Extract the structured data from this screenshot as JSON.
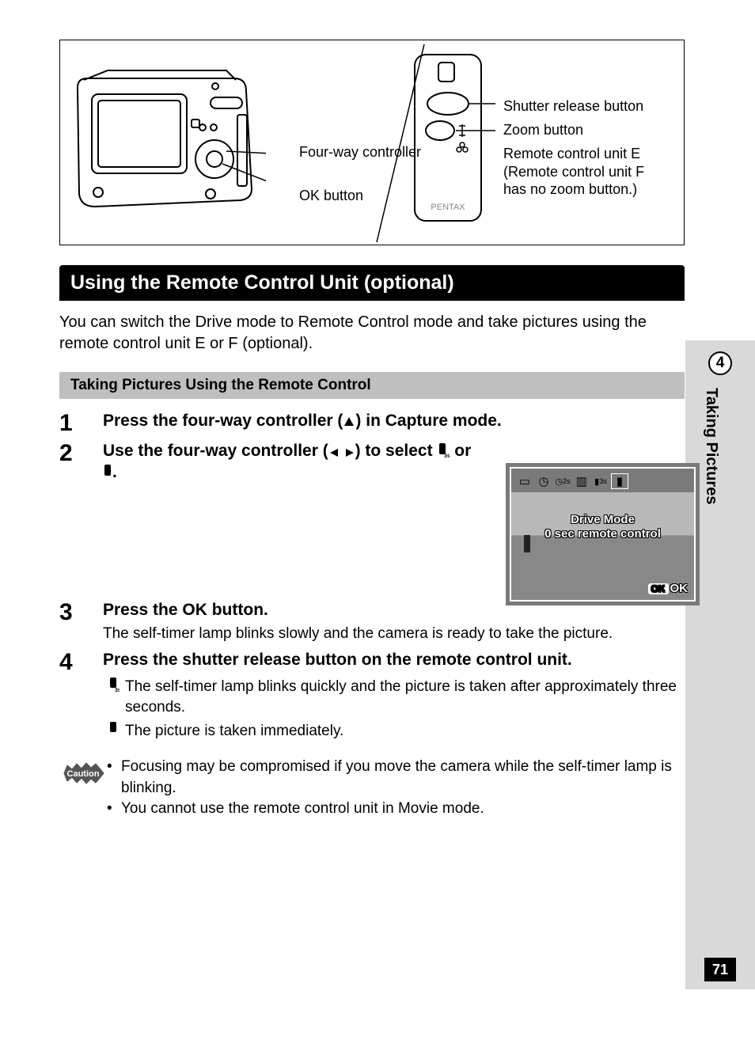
{
  "diagram": {
    "camera_labels": {
      "fourway": "Four-way controller",
      "ok": "OK button"
    },
    "remote_labels": {
      "shutter": "Shutter release button",
      "zoom": "Zoom button",
      "unit": "Remote control unit E (Remote control unit F has no zoom button.)"
    },
    "remote_brand": "PENTAX"
  },
  "section_title": "Using the Remote Control Unit (optional)",
  "intro": "You can switch the Drive mode to Remote Control mode and take pictures using the remote control unit E or F (optional).",
  "sub_header": "Taking Pictures Using the Remote Control",
  "steps": [
    {
      "num": "1",
      "title_pre": "Press the four-way controller (",
      "title_post": ") in Capture mode."
    },
    {
      "num": "2",
      "title_pre": "Use the four-way controller (",
      "title_mid": ") to select ",
      "title_or": " or ",
      "title_end": "."
    },
    {
      "num": "3",
      "title": "Press the OK button.",
      "desc": "The self-timer lamp blinks slowly and the camera is ready to take the picture."
    },
    {
      "num": "4",
      "title": "Press the shutter release button on the remote control unit.",
      "subitems": [
        "The self-timer lamp blinks quickly and the picture is taken after approximately three seconds.",
        "The picture is taken immediately."
      ]
    }
  ],
  "caution": {
    "label": "Caution",
    "items": [
      "Focusing may be compromised if you move the camera while the self-timer lamp is blinking.",
      "You cannot use the remote control unit in Movie mode."
    ]
  },
  "lcd": {
    "title": "Drive Mode",
    "subtitle": "0 sec remote control",
    "ok": "OK",
    "ok_badge": "OK"
  },
  "side": {
    "chapter": "4",
    "label": "Taking Pictures",
    "page": "71"
  }
}
